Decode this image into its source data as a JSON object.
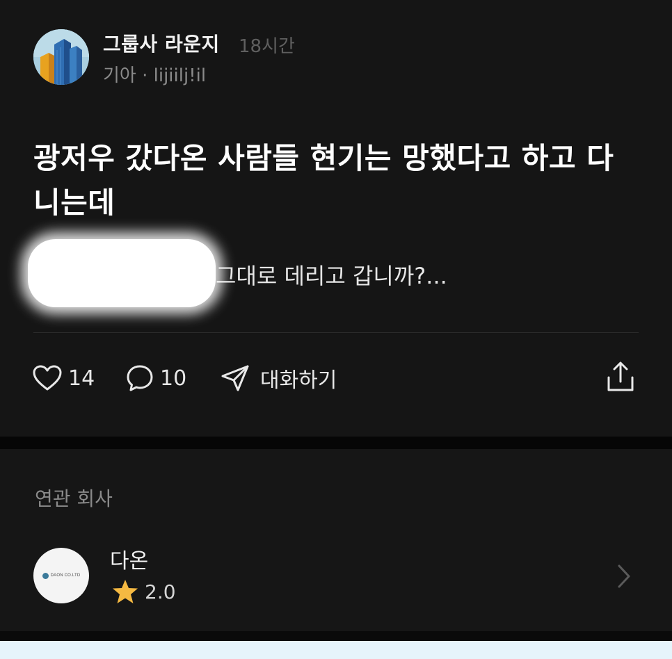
{
  "post": {
    "group_name": "그룹사 라운지",
    "time": "18시간",
    "meta": "기아 · lijiilj!il",
    "title": "광저우 갔다온 사람들 현기는 망했다고 하고 다니는데",
    "excerpt_visible": "그대로 데리고 갑니까?...",
    "actions": {
      "likes": "14",
      "comments": "10",
      "chat_label": "대화하기"
    }
  },
  "related": {
    "heading": "연관 회사",
    "company": {
      "name": "다온",
      "logo_text": "DAON CO.LTD",
      "rating": "2.0"
    }
  },
  "colors": {
    "background": "#151515",
    "star": "#f5b942",
    "bottom_bar": "#e6f4fb"
  },
  "icons": [
    "avatar-buildings-image",
    "heart-icon",
    "comment-icon",
    "send-icon",
    "share-icon",
    "star-icon",
    "chevron-right-icon"
  ]
}
